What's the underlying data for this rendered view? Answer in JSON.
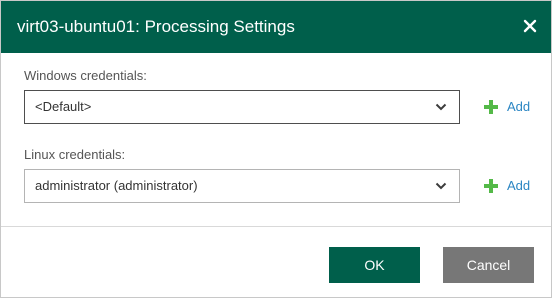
{
  "dialog": {
    "title": "virt03-ubuntu01: Processing Settings",
    "close_icon": "close-icon"
  },
  "windows_credentials": {
    "label": "Windows credentials:",
    "selected": "<Default>",
    "dropdown_icon": "chevron-down-icon",
    "add_icon": "plus-icon",
    "add_label": "Add"
  },
  "linux_credentials": {
    "label": "Linux credentials:",
    "selected": "administrator (administrator)",
    "dropdown_icon": "chevron-down-icon",
    "add_icon": "plus-icon",
    "add_label": "Add"
  },
  "footer": {
    "ok_label": "OK",
    "cancel_label": "Cancel"
  },
  "colors": {
    "header_bg": "#005f4b",
    "primary_button": "#005f4b",
    "secondary_button": "#777777",
    "add_icon": "#54b948",
    "link": "#2b86c3"
  }
}
